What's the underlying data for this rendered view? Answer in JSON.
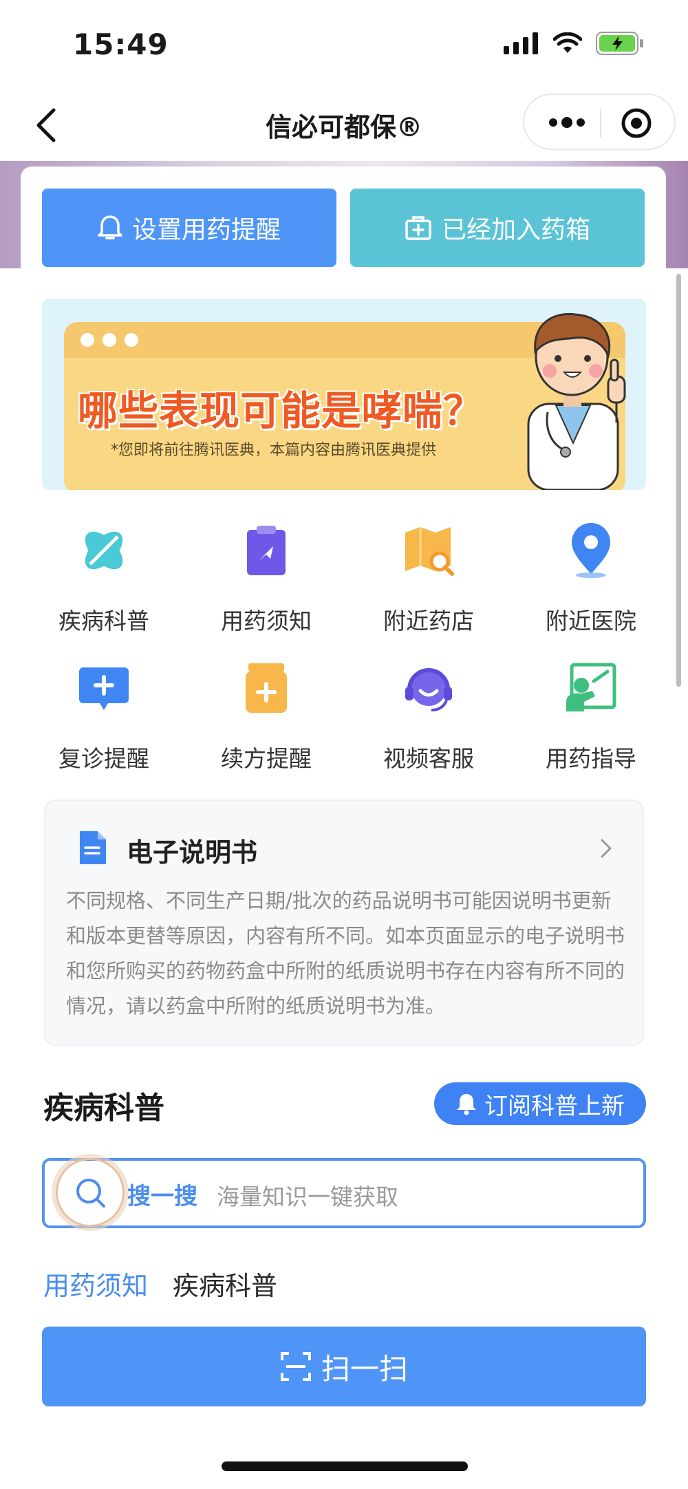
{
  "status_bar": {
    "time": "15:49"
  },
  "nav": {
    "title": "信必可都保®"
  },
  "actions": {
    "reminder_label": "设置用药提醒",
    "added_label": "已经加入药箱"
  },
  "banner": {
    "title": "哪些表现可能是哮喘？",
    "subtitle": "*您即将前往腾讯医典，本篇内容由腾讯医典提供"
  },
  "grid": [
    {
      "label": "疾病科普",
      "icon": "disease-science-icon"
    },
    {
      "label": "用药须知",
      "icon": "medication-notes-icon"
    },
    {
      "label": "附近药店",
      "icon": "nearby-pharmacy-icon"
    },
    {
      "label": "附近医院",
      "icon": "nearby-hospital-icon"
    },
    {
      "label": "复诊提醒",
      "icon": "followup-reminder-icon"
    },
    {
      "label": "续方提醒",
      "icon": "refill-reminder-icon"
    },
    {
      "label": "视频客服",
      "icon": "video-support-icon"
    },
    {
      "label": "用药指导",
      "icon": "medication-guide-icon"
    }
  ],
  "manual": {
    "title": "电子说明书",
    "text": "不同规格、不同生产日期/批次的药品说明书可能因说明书更新和版本更替等原因，内容有所不同。如本页面显示的电子说明书和您所购买的药物药盒中所附的纸质说明书存在内容有所不同的情况，请以药盒中所附的纸质说明书为准。"
  },
  "section": {
    "title": "疾病科普",
    "subscribe_label": "订阅科普上新"
  },
  "search": {
    "label": "搜一搜",
    "placeholder": "海量知识一键获取"
  },
  "tabs": [
    {
      "label": "用药须知",
      "active": true
    },
    {
      "label": "疾病科普",
      "active": false
    }
  ],
  "scan": {
    "label": "扫一扫"
  },
  "colors": {
    "primary": "#4f95f7",
    "teal": "#5bc3d6",
    "banner_title": "#ef5a24"
  }
}
